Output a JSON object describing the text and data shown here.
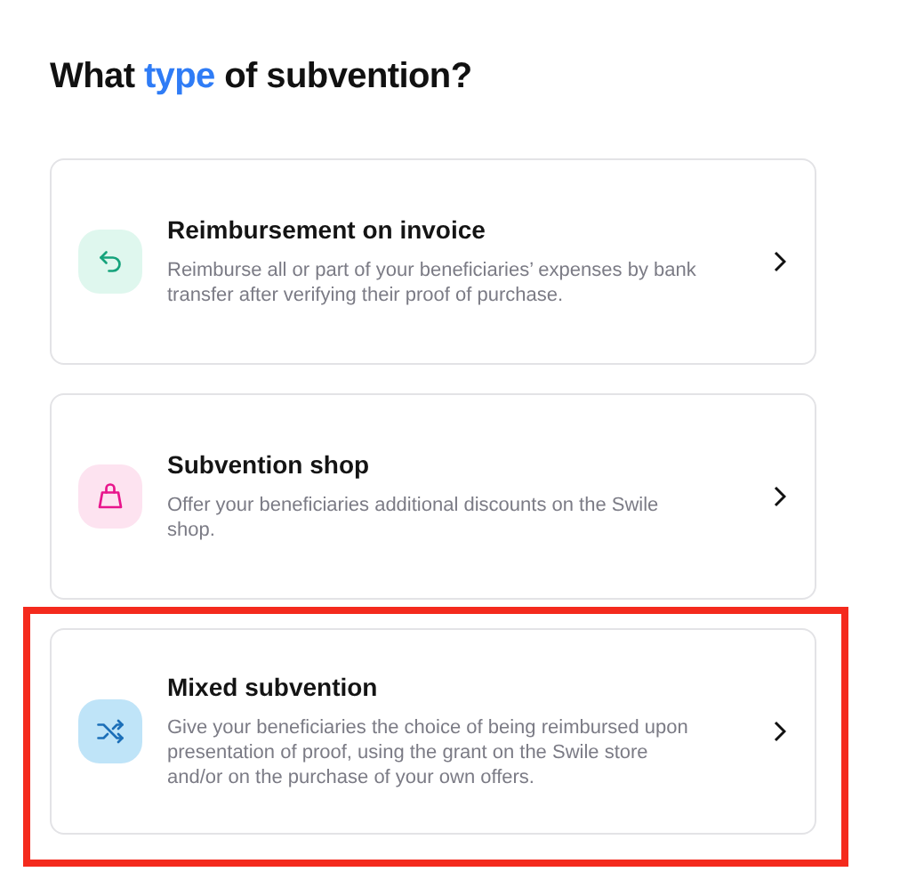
{
  "heading": [
    {
      "text": "What ",
      "accent": false
    },
    {
      "text": "type",
      "accent": true
    },
    {
      "text": " of subvention?",
      "accent": false
    }
  ],
  "options": [
    {
      "kind": "reimburse",
      "color": "#16a37c",
      "title": "Reimbursement on invoice",
      "description": "Reimburse all or part of your beneficiaries’ expenses by bank transfer after verifying their proof of purchase.",
      "selected": false
    },
    {
      "kind": "shop",
      "color": "#e8168c",
      "title": "Subvention shop",
      "description": "Offer your beneficiaries additional discounts on the Swile shop.",
      "selected": false
    },
    {
      "kind": "mixed",
      "color": "#1c6fb8",
      "title": "Mixed subvention",
      "description": "Give your beneficiaries the choice of being reimbursed upon presentation of proof, using the grant on the Swile store and/or on the purchase of your own offers.",
      "selected": true
    }
  ]
}
